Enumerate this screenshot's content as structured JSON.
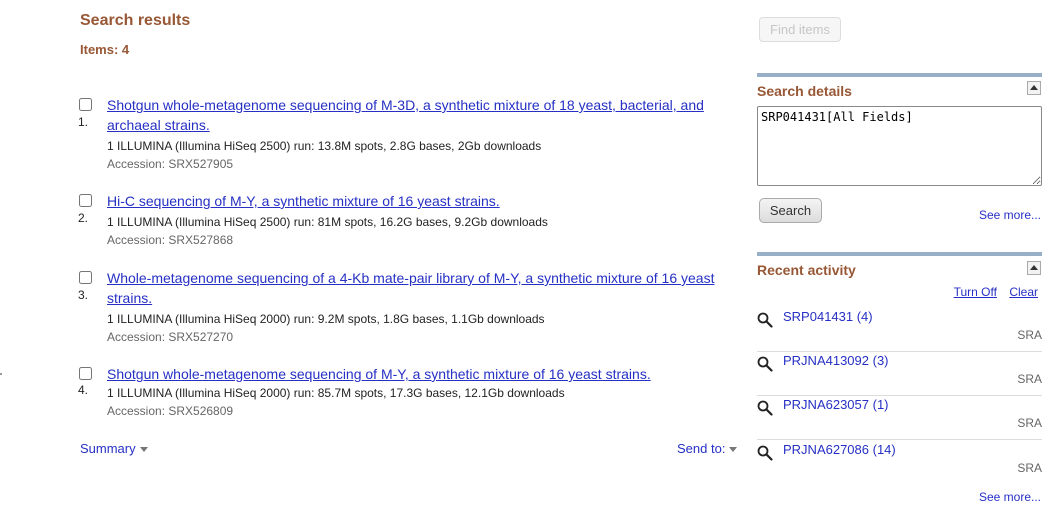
{
  "header": {
    "title": "Search results",
    "items_label": "Items: 4"
  },
  "results": [
    {
      "number": "1.",
      "title_line1": "Shotgun whole-metagenome sequencing of M-3D, a synthetic mixture of 18 yeast, bacterial, and",
      "title_line2": "archaeal strains.",
      "description": "1 ILLUMINA (Illumina HiSeq 2500) run: 13.8M spots, 2.8G bases, 2Gb downloads",
      "accession": "Accession: SRX527905"
    },
    {
      "number": "2.",
      "title_line1": "Hi-C sequencing of M-Y, a synthetic mixture of 16 yeast strains.",
      "title_line2": "",
      "description": "1 ILLUMINA (Illumina HiSeq 2500) run: 81M spots, 16.2G bases, 9.2Gb downloads",
      "accession": "Accession: SRX527868"
    },
    {
      "number": "3.",
      "title_line1": "Whole-metagenome sequencing of a 4-Kb mate-pair library of M-Y, a synthetic mixture of 16 yeast",
      "title_line2": "strains.",
      "description": "1 ILLUMINA (Illumina HiSeq 2000) run: 9.2M spots, 1.8G bases, 1.1Gb downloads",
      "accession": "Accession: SRX527270"
    },
    {
      "number": "4.",
      "title_line1": "Shotgun whole-metagenome sequencing of M-Y, a synthetic mixture of 16 yeast strains.",
      "title_line2": "",
      "description": "1 ILLUMINA (Illumina HiSeq 2000) run: 85.7M spots, 17.3G bases, 12.1Gb downloads",
      "accession": "Accession: SRX526809"
    }
  ],
  "footer": {
    "summary_label": "Summary",
    "send_to_label": "Send to:"
  },
  "sidebar": {
    "find_items_label": "Find items",
    "search_details": {
      "title": "Search details",
      "query": "SRP041431[All Fields]",
      "search_button": "Search",
      "see_more": "See more..."
    },
    "recent_activity": {
      "title": "Recent activity",
      "turn_off": "Turn Off",
      "clear": "Clear",
      "items": [
        {
          "label": "SRP041431 (4)",
          "db": "SRA"
        },
        {
          "label": "PRJNA413092 (3)",
          "db": "SRA"
        },
        {
          "label": "PRJNA623057 (1)",
          "db": "SRA"
        },
        {
          "label": "PRJNA627086 (14)",
          "db": "SRA"
        }
      ],
      "see_more": "See more..."
    }
  },
  "icons": {
    "collapse": "collapse-triangle-icon",
    "magnifier": "search-icon",
    "dropdown": "caret-down-icon"
  },
  "colors": {
    "heading": "#985735",
    "link": "#2630c4",
    "panel_bar": "#97b0c8"
  }
}
